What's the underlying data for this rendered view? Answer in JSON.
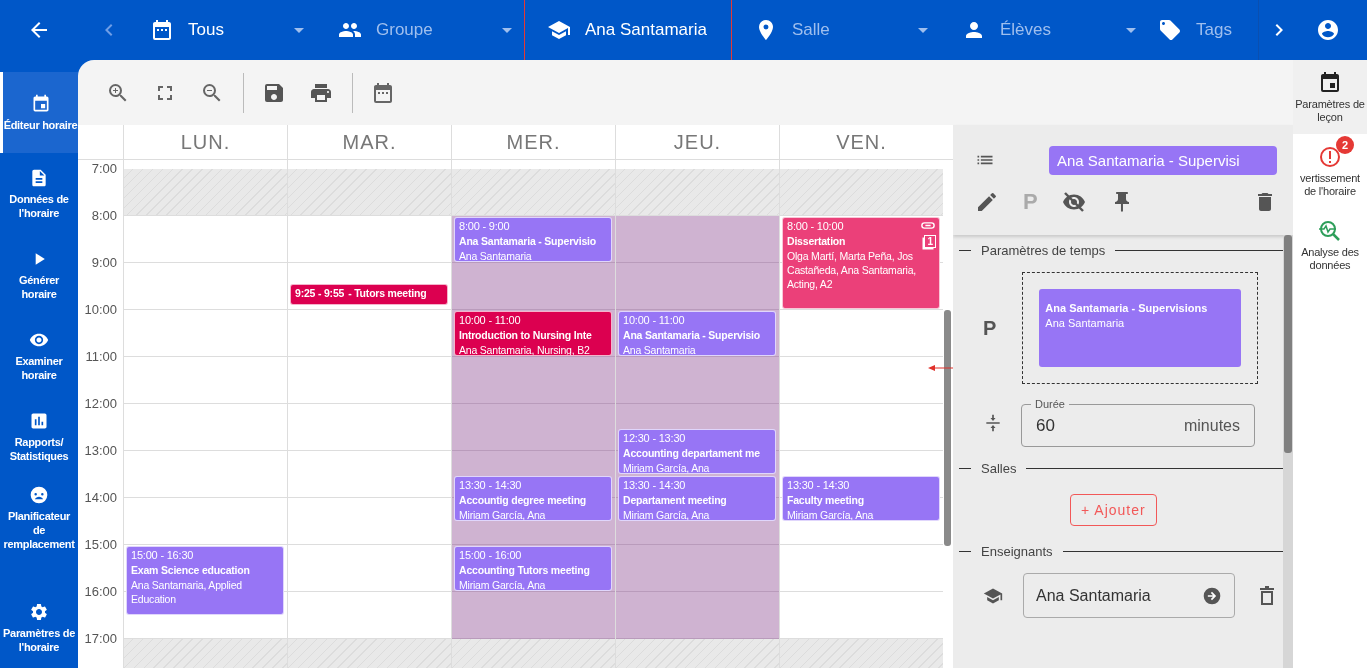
{
  "top_bar": {
    "filters": [
      {
        "label": "Tous",
        "kind": "calendar",
        "active": true,
        "selected": false
      },
      {
        "label": "Groupe",
        "kind": "group",
        "active": false,
        "selected": false
      },
      {
        "label": "Ana Santamaria",
        "kind": "teacher",
        "active": true,
        "selected": true
      },
      {
        "label": "Salle",
        "kind": "room",
        "active": false,
        "selected": false
      },
      {
        "label": "Élèves",
        "kind": "student",
        "active": false,
        "selected": false
      },
      {
        "label": "Tags",
        "kind": "tag",
        "active": false,
        "selected": false
      }
    ]
  },
  "sidebar": {
    "items": [
      {
        "label": "Éditeur horaire",
        "kind": "editor",
        "selected": true
      },
      {
        "label": "Données de l'horaire",
        "kind": "data",
        "selected": false
      },
      {
        "label": "Générer horaire",
        "kind": "generate",
        "selected": false
      },
      {
        "label": "Examiner horaire",
        "kind": "review",
        "selected": false
      },
      {
        "label": "Rapports/ Statistiques",
        "kind": "reports",
        "selected": false
      },
      {
        "label": "Planificateur de remplacement",
        "kind": "substitute",
        "selected": false
      },
      {
        "label": "Paramètres de l'horaire",
        "kind": "settings",
        "selected": false
      }
    ]
  },
  "calendar": {
    "hours": [
      {
        "label": "7:00",
        "closed": true
      },
      {
        "label": "8:00",
        "closed": false
      },
      {
        "label": "9:00",
        "closed": false
      },
      {
        "label": "10:00",
        "closed": false
      },
      {
        "label": "11:00",
        "closed": false
      },
      {
        "label": "12:00",
        "closed": false
      },
      {
        "label": "13:00",
        "closed": false
      },
      {
        "label": "14:00",
        "closed": false
      },
      {
        "label": "15:00",
        "closed": false
      },
      {
        "label": "16:00",
        "closed": false
      },
      {
        "label": "17:00",
        "closed": true
      }
    ],
    "days": [
      {
        "label": "LUN.",
        "highlighted": false,
        "events": [
          {
            "kind": "full",
            "time": "15:00 - 16:30",
            "title": "Exam Science education",
            "detail": "Ana Santamaria, Applied Education",
            "color": "#9775f5"
          }
        ]
      },
      {
        "label": "MAR.",
        "highlighted": false,
        "events": [
          {
            "kind": "compact",
            "time": "9:25 - 9:55",
            "title": "- Tutors meeting",
            "color": "#dc0050"
          }
        ]
      },
      {
        "label": "MER.",
        "highlighted": true,
        "events": [
          {
            "kind": "full",
            "time": "8:00 - 9:00",
            "title": "Ana Santamaria - Supervisio",
            "detail": "Ana Santamaria",
            "color": "#9775f5"
          },
          {
            "kind": "full",
            "time": "10:00 - 11:00",
            "title": "Introduction to Nursing Inte",
            "detail": "Ana Santamaria, Nursing, B2",
            "color": "#dc0050"
          },
          {
            "kind": "full",
            "time": "13:30 - 14:30",
            "title": "Accountig degree meeting",
            "detail": "Miriam García, Ana",
            "color": "#9775f5"
          },
          {
            "kind": "full",
            "time": "15:00 - 16:00",
            "title": "Accounting Tutors meeting",
            "detail": "Miriam García, Ana",
            "color": "#9775f5"
          }
        ]
      },
      {
        "label": "JEU.",
        "highlighted": true,
        "events": [
          {
            "kind": "full",
            "time": "10:00 - 11:00",
            "title": "Ana Santamaria - Supervisio",
            "detail": "Ana Santamaria",
            "color": "#9775f5"
          },
          {
            "kind": "full",
            "time": "12:30 - 13:30",
            "title": "Accounting departament me",
            "detail": "Miriam García, Ana",
            "color": "#9775f5"
          },
          {
            "kind": "full",
            "time": "13:30 - 14:30",
            "title": "Departament meeting",
            "detail": "Miriam García, Ana",
            "color": "#9775f5"
          }
        ]
      },
      {
        "label": "VEN.",
        "highlighted": false,
        "events": [
          {
            "kind": "full",
            "time": "8:00 - 10:00",
            "title": "Dissertation",
            "detail": "Olga Martí, Marta Peña, Jos Castañeda, Ana Santamaria, Acting, A2",
            "color": "#eb4079",
            "linked": true,
            "copies": "1"
          },
          {
            "kind": "full",
            "time": "13:30 - 14:30",
            "title": "Faculty meeting",
            "detail": "Miriam García, Ana",
            "color": "#9775f5"
          }
        ]
      }
    ]
  },
  "lesson_panel": {
    "title": "Ana Santamaria - Supervisi",
    "action_letter": "P",
    "time_section": "Paramètres de temps",
    "pin_letter": "P",
    "preview_title": "Ana Santamaria - Supervisions",
    "preview_detail": "Ana Santamaria",
    "duration": {
      "label": "Durée",
      "value": "60",
      "unit": "minutes"
    },
    "rooms_section": "Salles",
    "add_button": "+ Ajouter",
    "teachers_section": "Enseignants",
    "teachers": [
      "Ana Santamaria"
    ]
  },
  "right_rail": {
    "items": [
      {
        "label": "Paramètres de leçon",
        "kind": "lesson",
        "selected": true
      },
      {
        "label": "vertissement de l'horaire",
        "kind": "warnings",
        "selected": false,
        "badge": "2"
      },
      {
        "label": "Analyse des données",
        "kind": "analysis",
        "selected": false
      }
    ]
  }
}
